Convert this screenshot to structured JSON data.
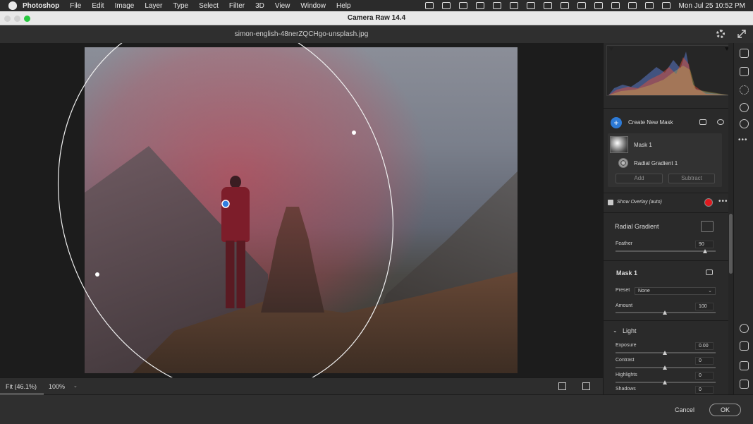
{
  "menubar": {
    "app": "Photoshop",
    "items": [
      "File",
      "Edit",
      "Image",
      "Layer",
      "Type",
      "Select",
      "Filter",
      "3D",
      "View",
      "Window",
      "Help"
    ],
    "clock": "Mon Jul 25  10:52 PM"
  },
  "window": {
    "title": "Camera Raw 14.4",
    "filename": "simon-english-48nerZQCHgo-unsplash.jpg"
  },
  "masks": {
    "create_new_mask": "Create New Mask",
    "mask_name": "Mask 1",
    "component": "Radial Gradient 1",
    "add_label": "Add",
    "subtract_label": "Subtract",
    "show_overlay": "Show Overlay (auto)",
    "overlay_color": "#e0191e"
  },
  "radial": {
    "title": "Radial Gradient",
    "feather_label": "Feather",
    "feather_value": "90"
  },
  "mask1": {
    "title": "Mask 1",
    "preset_label": "Preset",
    "preset_value": "None",
    "amount_label": "Amount",
    "amount_value": "100"
  },
  "light": {
    "title": "Light",
    "rows": [
      {
        "label": "Exposure",
        "value": "0.00"
      },
      {
        "label": "Contrast",
        "value": "0"
      },
      {
        "label": "Highlights",
        "value": "0"
      },
      {
        "label": "Shadows",
        "value": "0"
      }
    ]
  },
  "bottombar": {
    "fit": "Fit (46.1%)",
    "zoom": "100%"
  },
  "footer": {
    "cancel": "Cancel",
    "ok": "OK"
  }
}
